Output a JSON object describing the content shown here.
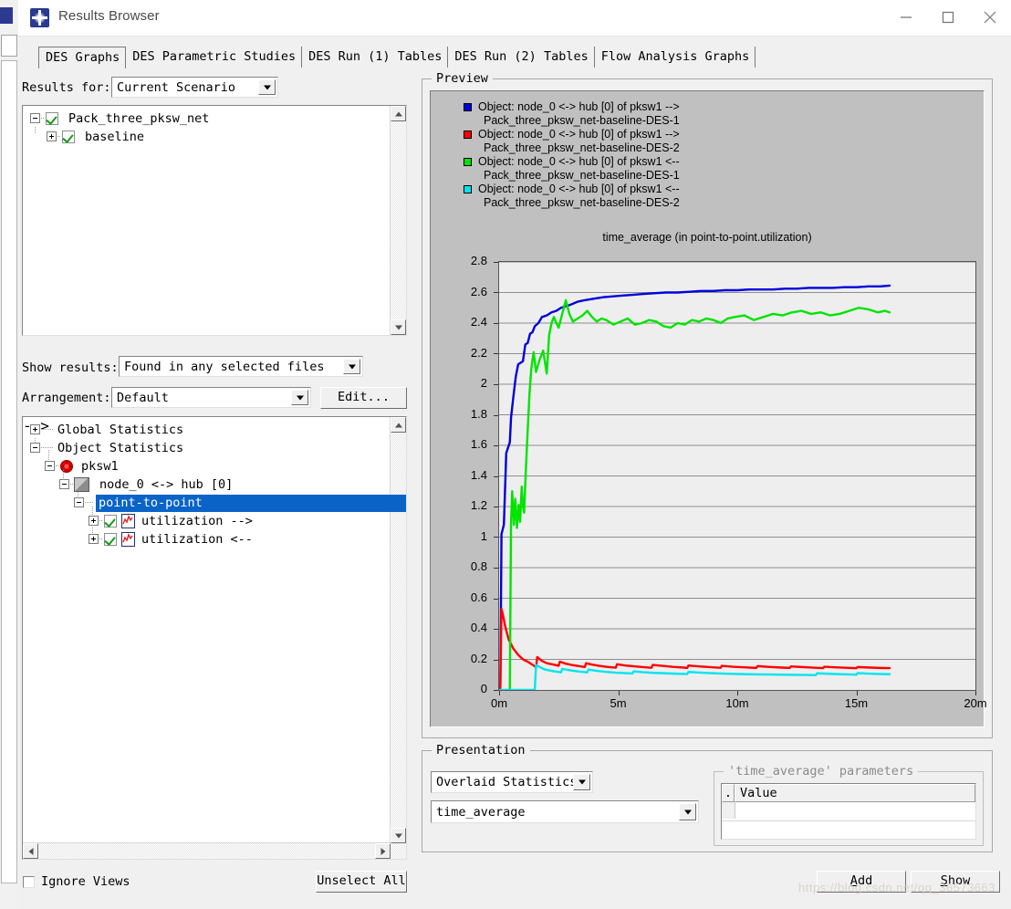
{
  "window": {
    "title": "Results Browser",
    "icon": "app-star-icon",
    "minimize": "minimize-icon",
    "maximize": "maximize-icon",
    "close": "close-icon"
  },
  "tabs": [
    {
      "label": "DES Graphs",
      "selected": true
    },
    {
      "label": "DES Parametric Studies",
      "selected": false
    },
    {
      "label": "DES Run (1) Tables",
      "selected": false
    },
    {
      "label": "DES Run (2) Tables",
      "selected": false
    },
    {
      "label": "Flow Analysis Graphs",
      "selected": false
    }
  ],
  "left": {
    "results_for_label": "Results for:",
    "results_for_value": "Current Scenario",
    "scenario_tree": [
      {
        "label": "Pack_three_pksw_net",
        "expander": "minus",
        "checked": true,
        "depth": 0
      },
      {
        "label": "baseline",
        "expander": "plus",
        "checked": true,
        "depth": 1
      }
    ],
    "show_results_label": "Show results:",
    "show_results_value": "Found in any selected files",
    "arrangement_label": "Arrangement:",
    "arrangement_value": "Default",
    "edit_button": "Edit...",
    "stat_tree": [
      {
        "label": "Global Statistics",
        "expander": "plus",
        "depth": 0,
        "icon": null,
        "checked": null,
        "selected": false
      },
      {
        "label": "Object Statistics",
        "expander": "minus",
        "depth": 0,
        "icon": null,
        "checked": null,
        "selected": false
      },
      {
        "label": "pksw1",
        "expander": "minus",
        "depth": 1,
        "icon": "red-node-icon",
        "checked": null,
        "selected": false
      },
      {
        "label": "node_0 <-> hub [0]",
        "expander": "minus",
        "depth": 2,
        "icon": "link-icon",
        "checked": null,
        "selected": false
      },
      {
        "label": "point-to-point",
        "expander": "minus",
        "depth": 3,
        "icon": null,
        "checked": null,
        "selected": true
      },
      {
        "label": "utilization -->",
        "expander": "plus",
        "depth": 4,
        "icon": "graph-icon",
        "checked": true,
        "selected": false
      },
      {
        "label": "utilization <--",
        "expander": "plus",
        "depth": 4,
        "icon": "graph-icon",
        "checked": true,
        "selected": false
      }
    ],
    "ignore_views_label": "Ignore Views",
    "ignore_views_checked": false,
    "unselect_all_button": "Unselect All"
  },
  "preview": {
    "group_title": "Preview",
    "legend": [
      {
        "color": "#0000dd",
        "line1": "Object: node_0 <-> hub [0] of pksw1 -->",
        "line2": "Pack_three_pksw_net-baseline-DES-1"
      },
      {
        "color": "#ff0000",
        "line1": "Object: node_0 <-> hub [0] of pksw1 -->",
        "line2": "Pack_three_pksw_net-baseline-DES-2"
      },
      {
        "color": "#00e400",
        "line1": "Object: node_0 <-> hub [0] of pksw1 <--",
        "line2": "Pack_three_pksw_net-baseline-DES-1"
      },
      {
        "color": "#00e5ee",
        "line1": "Object: node_0 <-> hub [0] of pksw1 <--",
        "line2": "Pack_three_pksw_net-baseline-DES-2"
      }
    ]
  },
  "chart_data": {
    "type": "line",
    "title": "time_average (in point-to-point.utilization)",
    "xlabel": "",
    "ylabel": "",
    "xlim": [
      0,
      20
    ],
    "ylim": [
      0,
      2.8
    ],
    "grid": true,
    "legend_position": "top",
    "xticks": [
      "0m",
      "5m",
      "10m",
      "15m",
      "20m"
    ],
    "xtick_values": [
      0,
      5,
      10,
      15,
      20
    ],
    "yticks": [
      "0",
      "0.2",
      "0.4",
      "0.6",
      "0.8",
      "1",
      "1.2",
      "1.4",
      "1.6",
      "1.8",
      "2",
      "2.2",
      "2.4",
      "2.6",
      "2.8"
    ],
    "ytick_values": [
      0,
      0.2,
      0.4,
      0.6,
      0.8,
      1.0,
      1.2,
      1.4,
      1.6,
      1.8,
      2.0,
      2.2,
      2.4,
      2.6,
      2.8
    ],
    "series": [
      {
        "name": "Object: node_0 <-> hub [0] of pksw1 --> Pack_three_pksw_net-baseline-DES-1",
        "color": "#0000dd",
        "x": [
          0.05,
          0.1,
          0.2,
          0.3,
          0.45,
          0.5,
          0.6,
          0.7,
          0.8,
          0.9,
          1.0,
          1.1,
          1.2,
          1.3,
          1.4,
          1.5,
          1.65,
          1.8,
          2.0,
          2.2,
          2.4,
          2.6,
          2.8,
          3.0,
          3.3,
          3.6,
          4.0,
          4.4,
          4.8,
          5.2,
          5.6,
          6.0,
          6.5,
          7.0,
          7.5,
          8.0,
          8.5,
          9.0,
          9.5,
          10.0,
          10.5,
          11.0,
          11.5,
          12.0,
          12.5,
          13.0,
          13.5,
          14.0,
          14.5,
          15.0,
          15.5,
          16.0,
          16.4
        ],
        "y": [
          0.0,
          1.02,
          1.08,
          1.55,
          1.62,
          1.78,
          1.92,
          2.05,
          2.13,
          2.14,
          2.15,
          2.26,
          2.27,
          2.33,
          2.34,
          2.38,
          2.4,
          2.44,
          2.45,
          2.47,
          2.48,
          2.5,
          2.51,
          2.52,
          2.54,
          2.55,
          2.56,
          2.57,
          2.575,
          2.58,
          2.585,
          2.59,
          2.595,
          2.6,
          2.6,
          2.605,
          2.61,
          2.61,
          2.615,
          2.615,
          2.62,
          2.62,
          2.62,
          2.625,
          2.625,
          2.63,
          2.63,
          2.63,
          2.635,
          2.635,
          2.64,
          2.64,
          2.645
        ]
      },
      {
        "name": "Object: node_0 <-> hub [0] of pksw1 --> Pack_three_pksw_net-baseline-DES-2",
        "color": "#ff0000",
        "x": [
          0.05,
          0.1,
          0.15,
          0.25,
          0.4,
          0.6,
          0.8,
          1.0,
          1.2,
          1.4,
          1.5,
          1.55,
          1.6,
          1.8,
          2.0,
          2.3,
          2.5,
          2.55,
          2.8,
          3.1,
          3.4,
          3.6,
          3.65,
          3.9,
          4.2,
          4.6,
          4.9,
          4.95,
          5.3,
          5.7,
          6.1,
          6.4,
          6.45,
          6.9,
          7.3,
          7.7,
          7.9,
          7.95,
          8.4,
          8.9,
          9.3,
          9.35,
          9.8,
          10.3,
          10.8,
          10.85,
          11.3,
          11.8,
          12.2,
          12.25,
          12.7,
          13.2,
          13.6,
          13.65,
          14.1,
          14.6,
          15.0,
          15.05,
          15.5,
          16.0,
          16.4
        ],
        "y": [
          0.0,
          0.53,
          0.5,
          0.42,
          0.33,
          0.27,
          0.23,
          0.2,
          0.185,
          0.165,
          0.155,
          0.145,
          0.215,
          0.19,
          0.175,
          0.165,
          0.158,
          0.185,
          0.172,
          0.162,
          0.155,
          0.15,
          0.175,
          0.166,
          0.158,
          0.15,
          0.146,
          0.168,
          0.16,
          0.154,
          0.149,
          0.145,
          0.164,
          0.157,
          0.151,
          0.147,
          0.144,
          0.16,
          0.154,
          0.149,
          0.145,
          0.158,
          0.152,
          0.148,
          0.144,
          0.156,
          0.151,
          0.147,
          0.144,
          0.154,
          0.15,
          0.146,
          0.143,
          0.152,
          0.148,
          0.145,
          0.142,
          0.15,
          0.147,
          0.144,
          0.143
        ]
      },
      {
        "name": "Object: node_0 <-> hub [0] of pksw1 <-- Pack_three_pksw_net-baseline-DES-1",
        "color": "#00e400",
        "x": [
          0.45,
          0.5,
          0.55,
          0.62,
          0.68,
          0.75,
          0.82,
          0.88,
          0.95,
          1.0,
          1.05,
          1.12,
          1.2,
          1.28,
          1.35,
          1.45,
          1.55,
          1.7,
          1.85,
          2.0,
          2.1,
          2.2,
          2.3,
          2.4,
          2.5,
          2.6,
          2.7,
          2.8,
          2.95,
          3.1,
          3.3,
          3.5,
          3.7,
          3.9,
          4.1,
          4.3,
          4.5,
          4.8,
          5.1,
          5.4,
          5.7,
          6.0,
          6.3,
          6.6,
          6.9,
          7.2,
          7.5,
          7.8,
          8.1,
          8.4,
          8.7,
          9.0,
          9.3,
          9.6,
          9.9,
          10.3,
          10.7,
          11.1,
          11.5,
          11.9,
          12.3,
          12.7,
          13.1,
          13.5,
          13.9,
          14.3,
          14.7,
          15.1,
          15.5,
          15.9,
          16.2,
          16.4
        ],
        "y": [
          0.0,
          1.09,
          1.3,
          1.08,
          1.25,
          1.06,
          1.21,
          1.1,
          1.33,
          1.2,
          1.16,
          1.43,
          1.7,
          1.95,
          2.1,
          2.21,
          2.08,
          2.16,
          2.22,
          2.07,
          2.32,
          2.4,
          2.44,
          2.4,
          2.37,
          2.43,
          2.49,
          2.55,
          2.46,
          2.41,
          2.43,
          2.45,
          2.48,
          2.44,
          2.41,
          2.43,
          2.42,
          2.39,
          2.41,
          2.43,
          2.39,
          2.4,
          2.42,
          2.41,
          2.38,
          2.37,
          2.4,
          2.39,
          2.42,
          2.41,
          2.43,
          2.42,
          2.4,
          2.43,
          2.44,
          2.45,
          2.42,
          2.44,
          2.46,
          2.45,
          2.47,
          2.48,
          2.46,
          2.47,
          2.45,
          2.46,
          2.48,
          2.5,
          2.49,
          2.47,
          2.48,
          2.47
        ]
      },
      {
        "name": "Object: node_0 <-> hub [0] of pksw1 <-- Pack_three_pksw_net-baseline-DES-2",
        "color": "#00e5ee",
        "x": [
          0.02,
          0.5,
          1.0,
          1.45,
          1.5,
          1.55,
          1.9,
          2.3,
          2.6,
          2.65,
          3.0,
          3.4,
          3.7,
          3.75,
          4.1,
          4.5,
          4.9,
          5.3,
          5.6,
          5.65,
          6.0,
          6.5,
          7.0,
          7.5,
          7.9,
          7.95,
          8.4,
          8.9,
          9.4,
          9.9,
          10.4,
          10.9,
          11.4,
          11.9,
          12.4,
          12.9,
          13.3,
          13.35,
          13.8,
          14.3,
          14.8,
          15.0,
          15.05,
          15.5,
          16.0,
          16.4
        ],
        "y": [
          0.0,
          0.0,
          0.0,
          0.0,
          0.005,
          0.163,
          0.135,
          0.122,
          0.115,
          0.138,
          0.128,
          0.12,
          0.115,
          0.133,
          0.125,
          0.118,
          0.113,
          0.11,
          0.108,
          0.122,
          0.117,
          0.112,
          0.109,
          0.106,
          0.104,
          0.118,
          0.114,
          0.11,
          0.107,
          0.105,
          0.103,
          0.102,
          0.101,
          0.1,
          0.099,
          0.098,
          0.097,
          0.109,
          0.106,
          0.103,
          0.101,
          0.1,
          0.11,
          0.107,
          0.104,
          0.103
        ]
      }
    ]
  },
  "presentation": {
    "group_title": "Presentation",
    "mode_value": "Overlaid Statistics",
    "stat_value": "time_average",
    "params_group_title": "'time_average' parameters",
    "params_columns": [
      ".",
      "Value"
    ],
    "params_rows": []
  },
  "footer": {
    "add_button": "Add",
    "show_button": "Show"
  },
  "watermark": "https://blog.csdn.net/qq_36573663"
}
